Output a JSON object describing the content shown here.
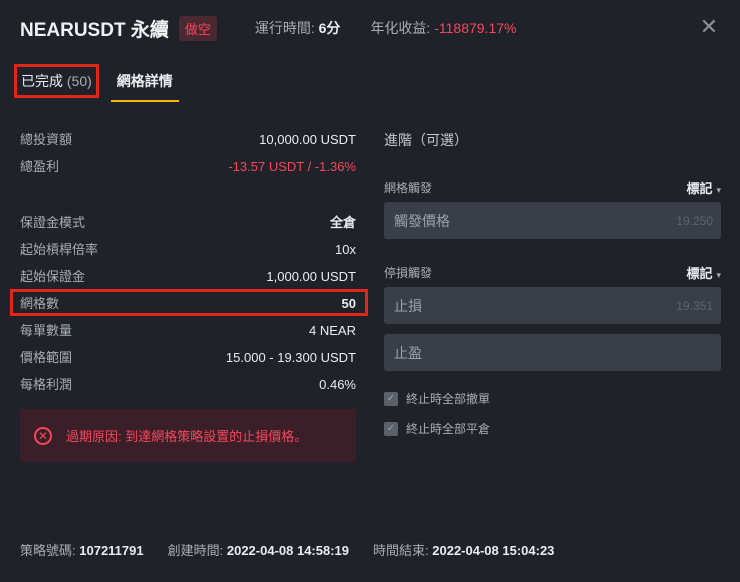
{
  "header": {
    "title": "NEARUSDT 永續",
    "short_badge": "做空",
    "runtime_label": "運行時間:",
    "runtime_value": "6分",
    "annual_label": "年化收益:",
    "annual_value": "-118879.17%",
    "close_glyph": "✕"
  },
  "tabs": {
    "completed_label": "已完成",
    "completed_count": "(50)",
    "detail_label": "網格詳情"
  },
  "details": {
    "total_investment_label": "總投資額",
    "total_investment_value": "10,000.00 USDT",
    "total_profit_label": "總盈利",
    "total_profit_value": "-13.57 USDT / -1.36%",
    "margin_mode_label": "保證金模式",
    "margin_mode_value": "全倉",
    "leverage_label": "起始槓桿倍率",
    "leverage_value": "10x",
    "initial_margin_label": "起始保證金",
    "initial_margin_value": "1,000.00 USDT",
    "grid_count_label": "網格數",
    "grid_count_value": "50",
    "qty_per_order_label": "每單數量",
    "qty_per_order_value": "4 NEAR",
    "price_range_label": "價格範圍",
    "price_range_value": "15.000 - 19.300 USDT",
    "profit_per_grid_label": "每格利潤",
    "profit_per_grid_value": "0.46%"
  },
  "alert": {
    "icon_glyph": "✕",
    "text": "過期原因: 到達網格策略設置的止損價格。"
  },
  "advanced": {
    "title": "進階（可選）",
    "trigger_label": "網格觸發",
    "trigger_select": "標記",
    "trigger_placeholder": "觸發價格",
    "trigger_value": "19.250",
    "stop_trigger_label": "停損觸發",
    "stop_trigger_select": "標記",
    "stop_loss_placeholder": "止損",
    "stop_loss_value": "19.351",
    "take_profit_placeholder": "止盈",
    "check_cancel_label": "終止時全部撤單",
    "check_close_label": "終止時全部平倉",
    "check_glyph": "✓",
    "caret_glyph": "▾"
  },
  "footer": {
    "strategy_id_label": "策略號碼:",
    "strategy_id_value": "107211791",
    "created_label": "創建時間:",
    "created_value": "2022-04-08 14:58:19",
    "ended_label": "時間結束:",
    "ended_value": "2022-04-08 15:04:23"
  },
  "colors": {
    "background": "#1f2329",
    "negative": "#f6465d",
    "accent": "#f0b90b",
    "highlight_box": "#e0271a"
  }
}
